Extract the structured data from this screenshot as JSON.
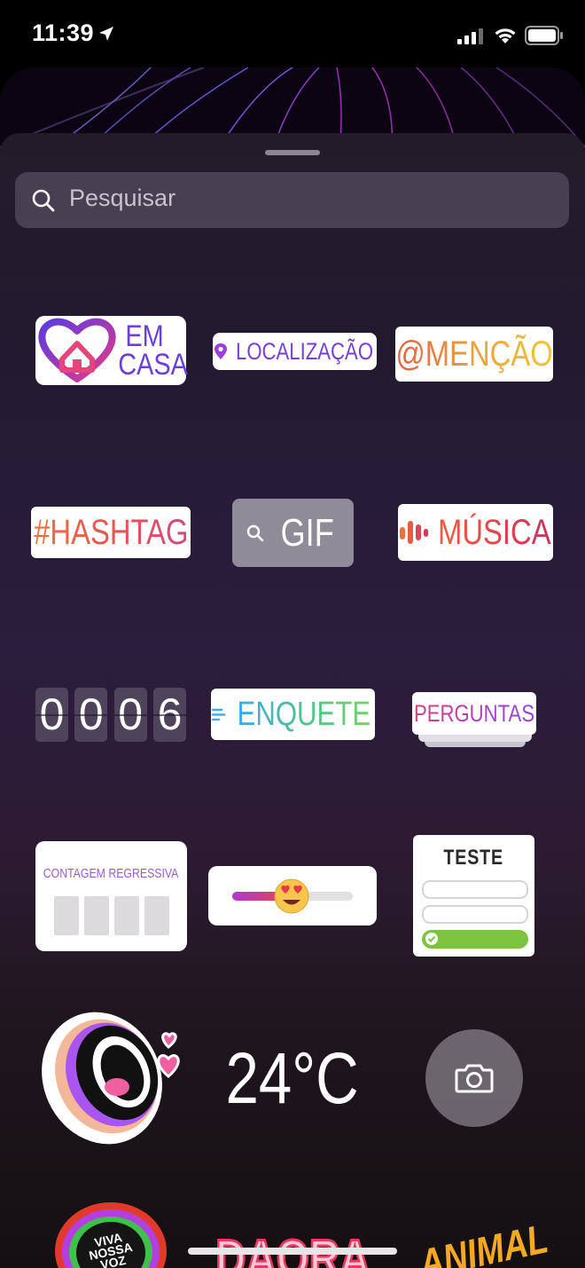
{
  "status_bar": {
    "time": "11:39"
  },
  "search": {
    "placeholder": "Pesquisar"
  },
  "stickers": {
    "em_casa": "EM CASA",
    "localizacao": "LOCALIZAÇÃO",
    "mencao": "@MENÇÃO",
    "hashtag": "#HASHTAG",
    "gif": "GIF",
    "musica": "MÚSICA",
    "countdown_digits": [
      "0",
      "0",
      "0",
      "6"
    ],
    "enquete": "ENQUETE",
    "perguntas": "PERGUNTAS",
    "contagem": "CONTAGEM REGRESSIVA",
    "teste": "TESTE",
    "temperature": "24°C",
    "viva": [
      "VIVA",
      "NOSSA",
      "VOZ"
    ],
    "daora": "DAORA",
    "animal": "ANIMAL"
  },
  "colors": {
    "sheet_top": "#221c2a",
    "sheet_mid": "#2b1d3d",
    "accent_purple": "#6a3fe0",
    "quiz_green": "#7cc43f"
  },
  "icons": [
    "location-arrow-icon",
    "signal-icon",
    "wifi-icon",
    "battery-icon",
    "search-icon",
    "map-pin-icon",
    "camera-icon"
  ]
}
